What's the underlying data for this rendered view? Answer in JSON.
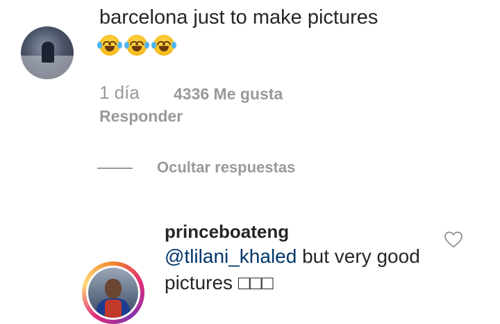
{
  "comment1": {
    "text": "barcelona just to make pictures",
    "emojis": [
      "face-with-tears-of-joy",
      "face-with-tears-of-joy",
      "face-with-tears-of-joy"
    ],
    "time": "1 día",
    "likes": "4336 Me gusta",
    "reply_label": "Responder"
  },
  "hide_replies_label": "Ocultar respuestas",
  "reply": {
    "username": "princeboateng",
    "mention": "@tlilani_khaled",
    "text_after_mention": " but very good pictures □□□"
  },
  "colors": {
    "text": "#262626",
    "muted": "#999999",
    "mention": "#003569"
  }
}
